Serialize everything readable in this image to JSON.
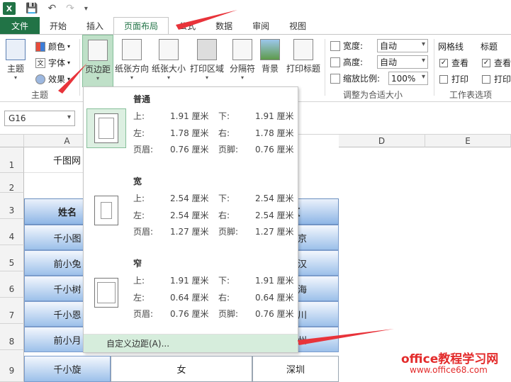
{
  "tabs": [
    "文件",
    "开始",
    "插入",
    "页面布局",
    "公式",
    "数据",
    "审阅",
    "视图"
  ],
  "active_tab": "页面布局",
  "ribbon": {
    "theme_group": {
      "theme_btn": "主题",
      "colors": "颜色",
      "fonts": "字体",
      "effects": "效果",
      "label": "主题"
    },
    "page_setup": {
      "margins": "页边距",
      "orientation": "纸张方向",
      "size": "纸张大小",
      "print_area": "打印区域",
      "breaks": "分隔符",
      "background": "背景",
      "print_titles": "打印标题"
    },
    "scale_group": {
      "width_label": "宽度:",
      "width_value": "自动",
      "height_label": "高度:",
      "height_value": "自动",
      "scale_label": "缩放比例:",
      "scale_value": "100%",
      "label": "调整为合适大小"
    },
    "sheet_options": {
      "gridlines": "网格线",
      "headings": "标题",
      "view": "查看",
      "print": "打印",
      "label": "工作表选项"
    }
  },
  "name_box": "G16",
  "sheet": {
    "columns": [
      "A",
      "D",
      "E"
    ],
    "rows": [
      "1",
      "2",
      "3",
      "4",
      "5",
      "6",
      "7",
      "8",
      "9"
    ],
    "a1": "千图网",
    "header": {
      "name": "姓名",
      "region": "区"
    },
    "names": [
      "千小图",
      "前小兔",
      "千小树",
      "千小恩",
      "前小月",
      "千小旋"
    ],
    "regions": [
      "京",
      "汉",
      "海",
      "川",
      "州",
      "深圳"
    ],
    "row9_gender": "女"
  },
  "margins_menu": {
    "options": [
      {
        "title": "普通",
        "top_label": "上:",
        "top": "1.91 厘米",
        "bottom_label": "下:",
        "bottom": "1.91 厘米",
        "left_label": "左:",
        "left": "1.78 厘米",
        "right_label": "右:",
        "right": "1.78 厘米",
        "header_label": "页眉:",
        "header": "0.76 厘米",
        "footer_label": "页脚:",
        "footer": "0.76 厘米"
      },
      {
        "title": "宽",
        "top_label": "上:",
        "top": "2.54 厘米",
        "bottom_label": "下:",
        "bottom": "2.54 厘米",
        "left_label": "左:",
        "left": "2.54 厘米",
        "right_label": "右:",
        "right": "2.54 厘米",
        "header_label": "页眉:",
        "header": "1.27 厘米",
        "footer_label": "页脚:",
        "footer": "1.27 厘米"
      },
      {
        "title": "窄",
        "top_label": "上:",
        "top": "1.91 厘米",
        "bottom_label": "下:",
        "bottom": "1.91 厘米",
        "left_label": "左:",
        "left": "0.64 厘米",
        "right_label": "右:",
        "right": "0.64 厘米",
        "header_label": "页眉:",
        "header": "0.76 厘米",
        "footer_label": "页脚:",
        "footer": "0.76 厘米"
      }
    ],
    "custom": "自定义边距(A)..."
  },
  "watermark": {
    "line1": "office教程学习网",
    "line2": "www.office68.com"
  },
  "colors": {
    "excel_green": "#217346",
    "arrow_red": "#e8333a"
  }
}
